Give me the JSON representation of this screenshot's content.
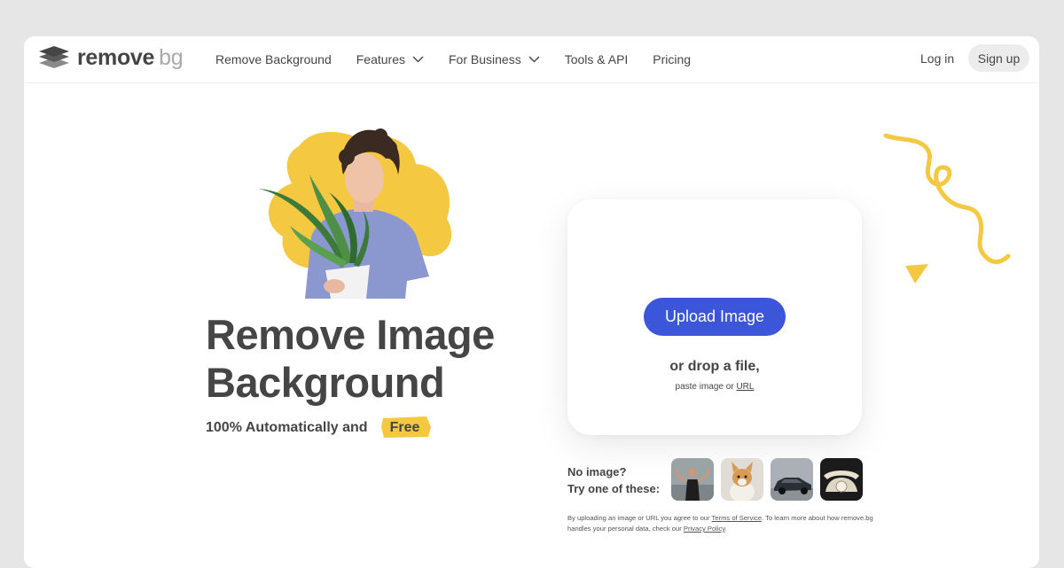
{
  "brand": {
    "name": "remove",
    "suffix": "bg",
    "accent": "#3c56d9",
    "highlight": "#f5c842"
  },
  "nav": {
    "items": [
      {
        "label": "Remove Background",
        "dropdown": false
      },
      {
        "label": "Features",
        "dropdown": true
      },
      {
        "label": "For Business",
        "dropdown": true
      },
      {
        "label": "Tools & API",
        "dropdown": false
      },
      {
        "label": "Pricing",
        "dropdown": false
      }
    ],
    "login": "Log in",
    "signup": "Sign up"
  },
  "hero": {
    "title_line1": "Remove Image",
    "title_line2": "Background",
    "subtitle_prefix": "100% Automatically and",
    "subtitle_highlight": "Free"
  },
  "upload": {
    "button": "Upload Image",
    "drop_text": "or drop a file,",
    "paste_text": "paste image or",
    "url_link": "URL"
  },
  "samples": {
    "label_line1": "No image?",
    "label_line2": "Try one of these:",
    "thumbnails": [
      "woman-flexing",
      "corgi-dog",
      "car",
      "rotary-telephone"
    ]
  },
  "legal": {
    "part1": "By uploading an image or URL you agree to our",
    "tos": "Terms of Service",
    "part2": ". To learn more about how remove.bg handles your personal data, check our",
    "privacy": "Privacy Policy",
    "part3": "."
  }
}
